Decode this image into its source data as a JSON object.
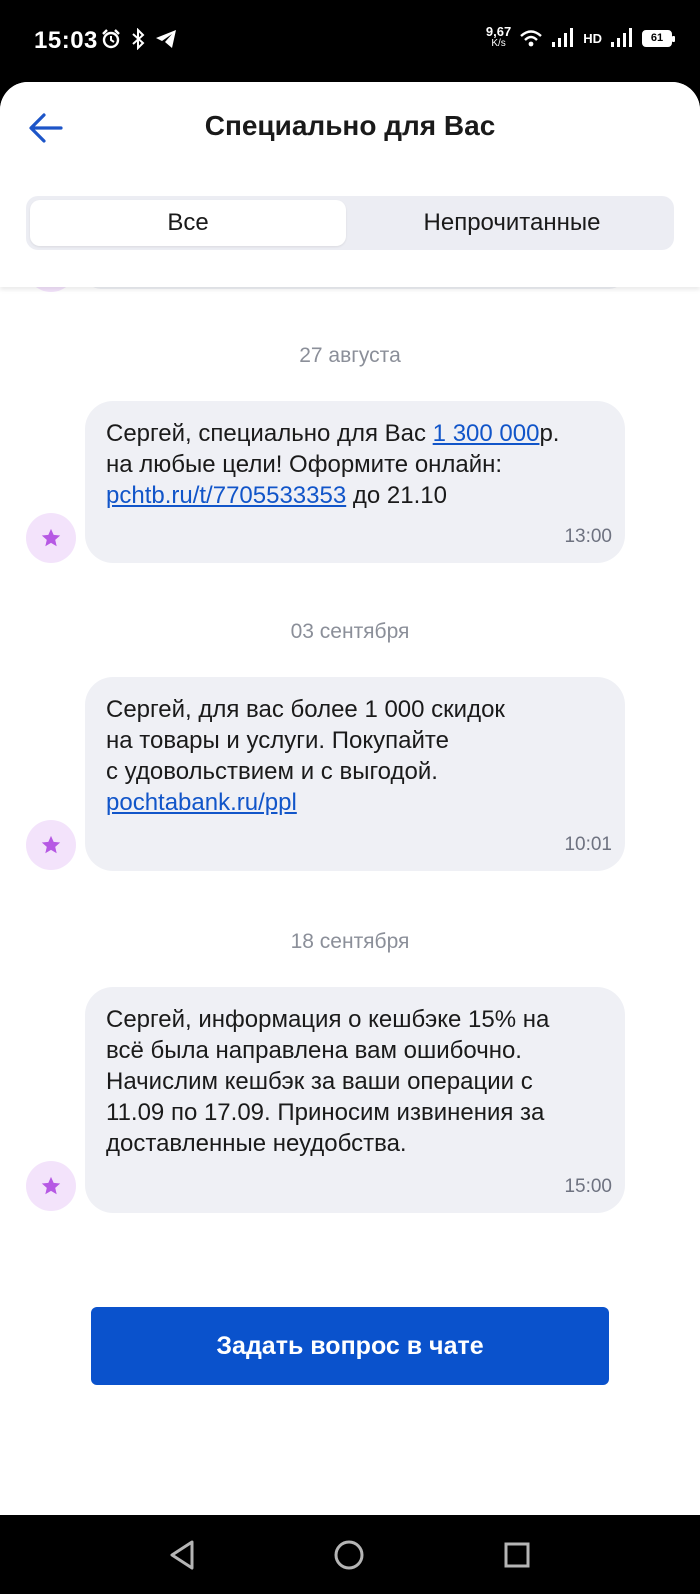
{
  "status_bar": {
    "time": "15:03",
    "net_speed_value": "9,67",
    "net_speed_unit": "K/s",
    "network_label": "HD",
    "battery_level": "61"
  },
  "header": {
    "title": "Специально для Вас",
    "tabs": [
      {
        "label": "Все",
        "active": true
      },
      {
        "label": "Непрочитанные",
        "active": false
      }
    ]
  },
  "messages": [
    {
      "date": "27 августа",
      "parts": [
        {
          "t": "Сергей, специально для Вас "
        },
        {
          "t": "1 300 000",
          "link": true
        },
        {
          "t": "р."
        },
        {
          "br": true
        },
        {
          "t": "на любые цели! Оформите онлайн:"
        },
        {
          "br": true
        },
        {
          "t": "pchtb.ru/t/7705533353",
          "link": true
        },
        {
          "t": " до 21.10"
        }
      ],
      "time": "13:00"
    },
    {
      "date": "03 сентября",
      "parts": [
        {
          "t": "Сергей, для вас более 1 000 скидок"
        },
        {
          "br": true
        },
        {
          "t": "на товары и услуги. Покупайте"
        },
        {
          "br": true
        },
        {
          "t": "с удовольствием и с выгодой."
        },
        {
          "br": true
        },
        {
          "t": "pochtabank.ru/ppl",
          "link": true
        }
      ],
      "time": "10:01"
    },
    {
      "date": "18 сентября",
      "parts": [
        {
          "t": "Сергей, информация о кешбэке 15% на"
        },
        {
          "br": true
        },
        {
          "t": "всё была направлена вам ошибочно."
        },
        {
          "br": true
        },
        {
          "t": "Начислим кешбэк за ваши операции с"
        },
        {
          "br": true
        },
        {
          "t": "11.09 по 17.09. Приносим извинения за"
        },
        {
          "br": true
        },
        {
          "t": "доставленные неудобства."
        }
      ],
      "time": "15:00"
    }
  ],
  "chat_button_label": "Задать вопрос в чате",
  "colors": {
    "accent": "#0a52cc",
    "link": "#1155c9",
    "bubble": "#eff0f5",
    "avatar_bg": "#f3e3fb",
    "star": "#b659e4"
  },
  "icons": {
    "back": "arrow-left-icon",
    "avatar": "star-icon",
    "nav_back": "triangle-back-icon",
    "nav_home": "circle-home-icon",
    "nav_recents": "square-recents-icon"
  }
}
